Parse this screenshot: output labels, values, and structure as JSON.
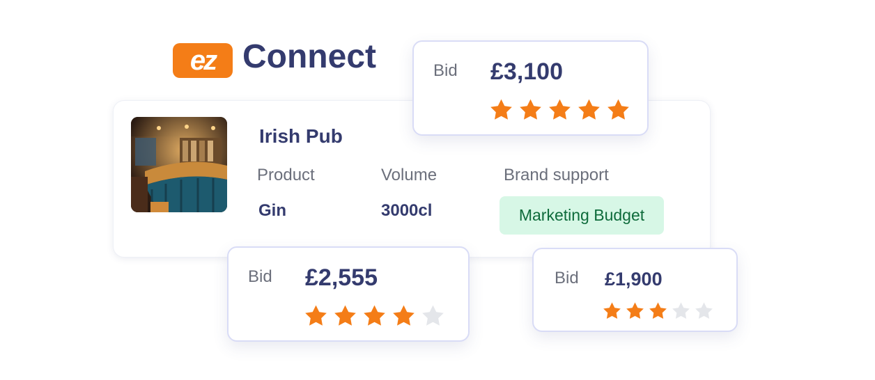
{
  "brand": {
    "logo_text": "ez",
    "name": "Connect",
    "accent": "#f47d17",
    "text_color": "#343b6e"
  },
  "venue": {
    "title": "Irish Pub",
    "photo_icon": "pub-interior-photo",
    "columns": {
      "product": {
        "label": "Product",
        "value": "Gin"
      },
      "volume": {
        "label": "Volume",
        "value": "3000cl"
      },
      "brand_support": {
        "label": "Brand support",
        "value": "Marketing Budget"
      }
    }
  },
  "bids": [
    {
      "label": "Bid",
      "amount": "£3,100",
      "rating": 5,
      "max_rating": 5
    },
    {
      "label": "Bid",
      "amount": "£2,555",
      "rating": 4,
      "max_rating": 5
    },
    {
      "label": "Bid",
      "amount": "£1,900",
      "rating": 3,
      "max_rating": 5
    }
  ],
  "colors": {
    "star_filled": "#f47d17",
    "star_empty": "#e4e6ea",
    "badge_bg": "#d7f7e6",
    "badge_text": "#0e6b3b"
  }
}
